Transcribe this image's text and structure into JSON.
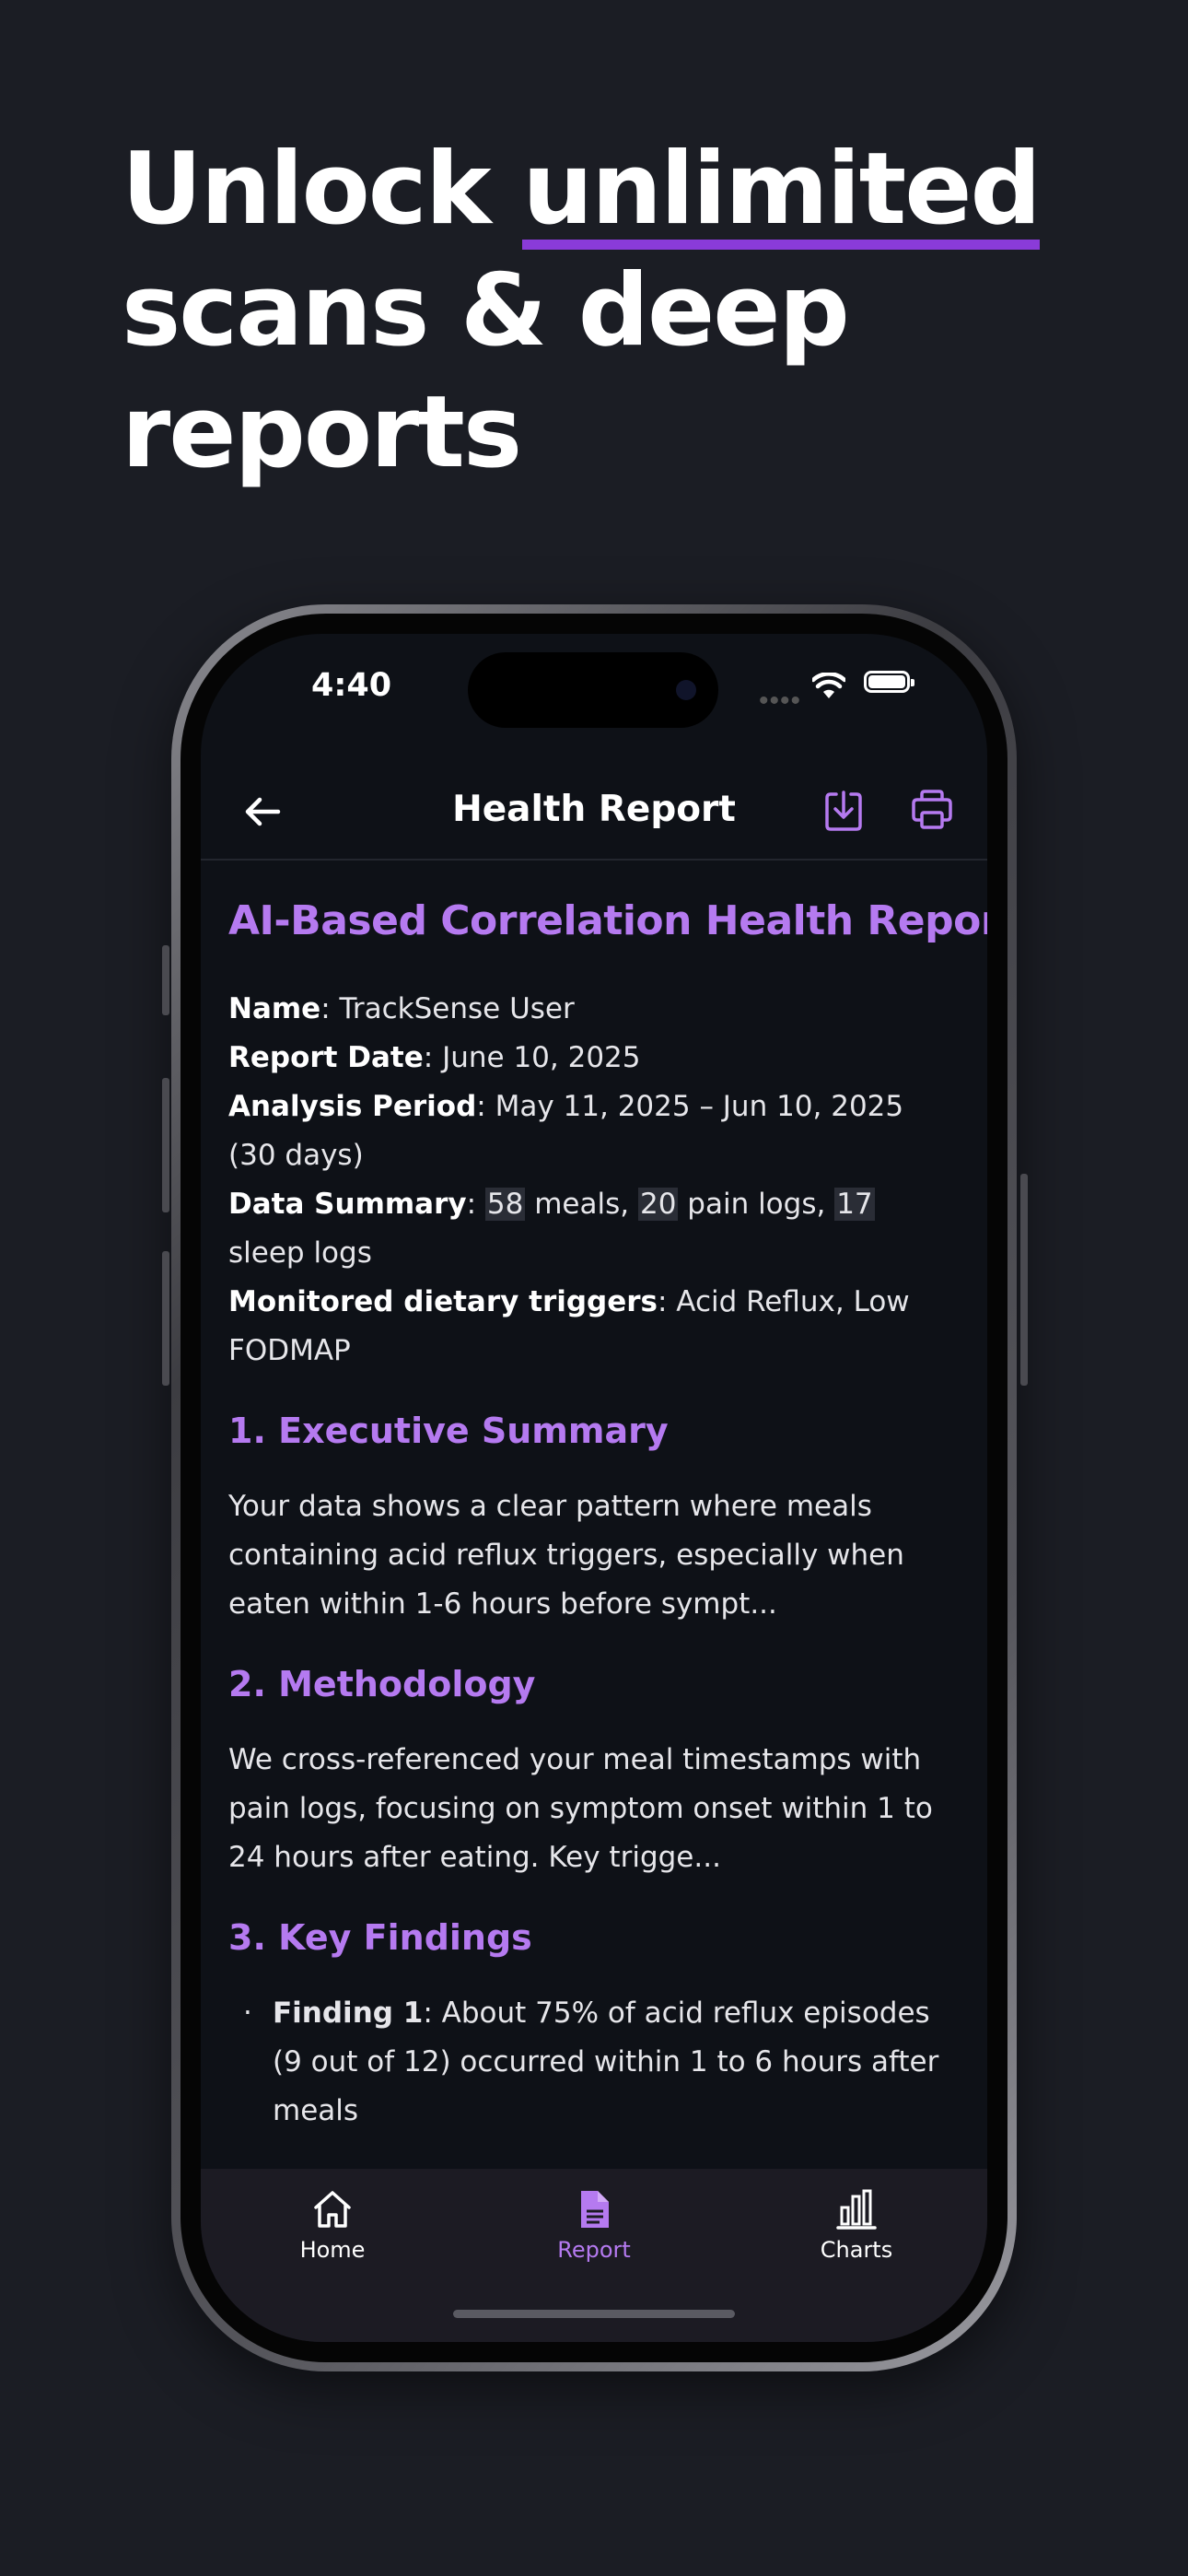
{
  "headline": {
    "line1_prefix": "Unlock ",
    "line1_highlight": "unlimited",
    "line2": "scans & deep",
    "line3": "reports"
  },
  "status_bar": {
    "time": "4:40",
    "dots": "••••"
  },
  "navbar": {
    "title": "Health Report"
  },
  "report": {
    "title": "AI-Based Correlation Health Report",
    "meta": {
      "name_label": "Name",
      "name_value": ": TrackSense User",
      "date_label": "Report Date",
      "date_value": ": June 10, 2025",
      "period_label": "Analysis Period",
      "period_value": ": May 11, 2025 – Jun 10, 2025 (30 days)",
      "summary_label": "Data Summary",
      "summary_sep": ": ",
      "meals_count": "58",
      "meals_text": " meals, ",
      "pain_count": "20",
      "pain_text": " pain logs, ",
      "sleep_count": "17",
      "sleep_text": " sleep logs",
      "triggers_label": "Monitored dietary triggers",
      "triggers_value": ": Acid Reflux, Low FODMAP"
    },
    "sections": {
      "executive_heading": "1. Executive Summary",
      "executive_text": "Your data shows a clear pattern where meals containing acid reflux triggers, especially when eaten within 1-6 hours before sympt...",
      "methodology_heading": "2. Methodology",
      "methodology_text": "We cross-referenced your meal timestamps with pain logs, focusing on symptom onset within 1 to 24 hours after eating. Key trigge...",
      "findings_heading": "3. Key Findings",
      "finding1_label": "Finding 1",
      "finding1_text": ": About 75% of acid reflux episodes (9 out of 12) occurred within 1 to 6 hours after meals"
    }
  },
  "tabbar": {
    "home": "Home",
    "report": "Report",
    "charts": "Charts",
    "active": "report"
  },
  "colors": {
    "accent": "#b57af0",
    "headline_underline": "#8a3bd9",
    "background": "#1b1d24",
    "screen": "#0e1117"
  },
  "icons": [
    "back-arrow-icon",
    "download-icon",
    "print-icon",
    "home-icon",
    "document-icon",
    "bar-chart-icon",
    "wifi-icon",
    "battery-icon"
  ]
}
